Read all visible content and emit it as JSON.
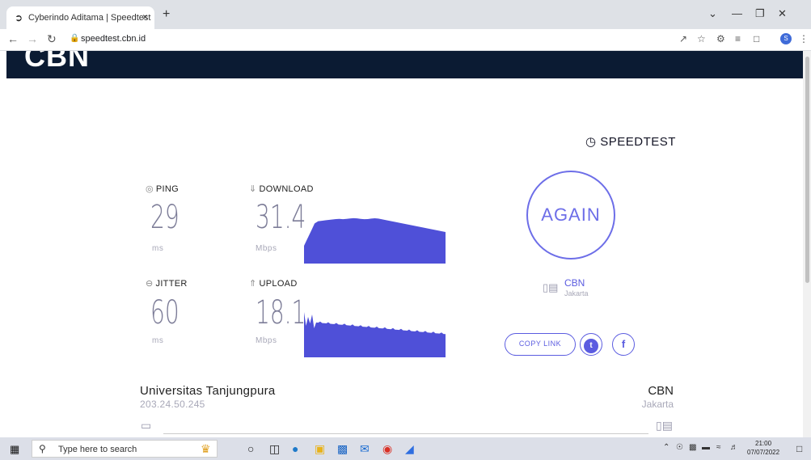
{
  "browser": {
    "tab_title": "Cyberindo Aditama | Speedtest",
    "tab_close": "×",
    "new_tab": "+",
    "url": "speedtest.cbn.id"
  },
  "site": {
    "logo": "CBN"
  },
  "speedtest": {
    "brand": "SPEEDTEST",
    "ping": {
      "label": "PING",
      "value": "29",
      "unit": "ms"
    },
    "download": {
      "label": "DOWNLOAD",
      "value": "31.4",
      "unit": "Mbps"
    },
    "jitter": {
      "label": "JITTER",
      "value": "60",
      "unit": "ms"
    },
    "upload": {
      "label": "UPLOAD",
      "value": "18.1",
      "unit": "Mbps"
    },
    "again_label": "AGAIN",
    "server": {
      "name": "CBN",
      "location": "Jakarta"
    },
    "copy_link": "COPY LINK",
    "twitter": "t",
    "facebook": "f"
  },
  "connection": {
    "isp": "Universitas Tanjungpura",
    "ip": "203.24.50.245",
    "host": "CBN",
    "host_location": "Jakarta"
  },
  "taskbar": {
    "search_placeholder": "Type here to search",
    "time": "21:00",
    "date": "07/07/2022"
  },
  "colors": {
    "accent": "#5b5ce0",
    "graph_fill": "#4f50d8",
    "header_bg": "#0b1b33"
  }
}
